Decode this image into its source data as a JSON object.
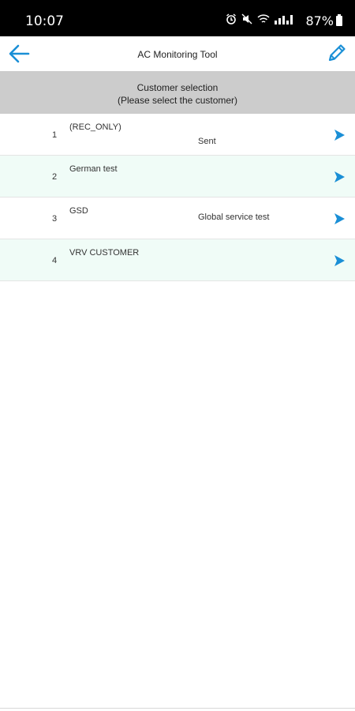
{
  "status_bar": {
    "time": "10:07",
    "battery": "87%",
    "icons": [
      "alarm-icon",
      "mute-icon",
      "wifi-icon",
      "signal-icon",
      "battery-icon"
    ]
  },
  "header": {
    "title": "AC Monitoring Tool",
    "back_icon": "arrow-left-icon",
    "edit_icon": "pencil-icon"
  },
  "section": {
    "title": "Customer selection",
    "subtitle": "(Please select the customer)"
  },
  "customers": [
    {
      "number": "1",
      "name": "(REC_ONLY)",
      "extra": "Sent"
    },
    {
      "number": "2",
      "name": "German test",
      "extra": ""
    },
    {
      "number": "3",
      "name": "GSD",
      "extra": "Global service test"
    },
    {
      "number": "4",
      "name": "VRV CUSTOMER",
      "extra": ""
    }
  ],
  "colors": {
    "accent": "#1a8fd6",
    "header_band": "#cccccc",
    "alt_row": "#f0fcf7"
  }
}
